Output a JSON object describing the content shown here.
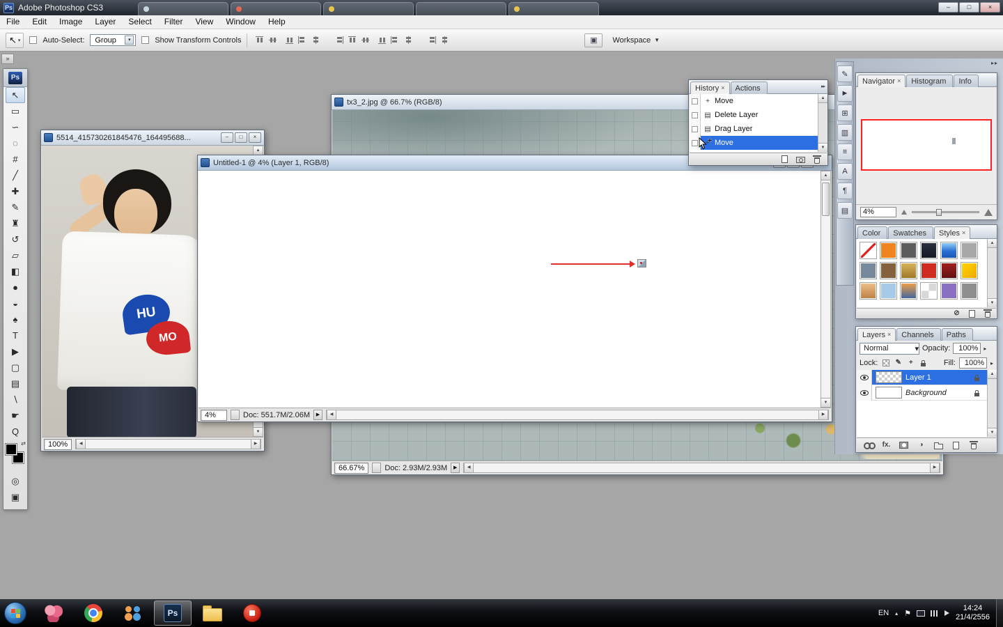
{
  "colors": {
    "selection_blue": "#2b6fe3",
    "annotation_red": "#e03028",
    "navigator_frame_red": "#ff1f1f",
    "photoshop_badge_blue": "#12294f",
    "taskbar_black": "#0d0f13"
  },
  "ui": {
    "arrow_down": "▾",
    "arrow_down_solid": "▼",
    "arrow_right": "▸",
    "chevrons": "▸▸",
    "collapse": "»",
    "scroll_up": "▲",
    "scroll_down": "▼",
    "scroll_left": "◀",
    "scroll_right": "▶",
    "swap": "⇄",
    "quickmask": "◎",
    "screenmode": "▣"
  },
  "titlebar": {
    "title": "Adobe Photoshop CS3",
    "badge": "Ps",
    "min": "–",
    "max": "□",
    "close": "×",
    "ghost_tabs": [
      {
        "dot": "#c8d4e0"
      },
      {
        "dot": "#df6a55"
      },
      {
        "dot": "#e6c44f"
      },
      {
        "dot": ""
      },
      {
        "dot": "#e6c44f"
      }
    ]
  },
  "menu": {
    "items": [
      "File",
      "Edit",
      "Image",
      "Layer",
      "Select",
      "Filter",
      "View",
      "Window",
      "Help"
    ]
  },
  "options": {
    "tool_glyph": "↖",
    "auto_select_label": "Auto-Select:",
    "auto_select_value": "Group",
    "show_transform_label": "Show Transform Controls",
    "bridge_glyph": "▣",
    "workspace_label": "Workspace",
    "align_icons": [
      {
        "name": "align-top-edges-icon",
        "v": "top"
      },
      {
        "name": "align-vertical-centers-icon",
        "v": "vmid"
      },
      {
        "name": "align-bottom-edges-icon",
        "v": "bot"
      },
      {
        "name": "align-left-edges-icon",
        "v": "left"
      },
      {
        "name": "align-horizontal-centers-icon",
        "v": "hmid"
      },
      {
        "name": "align-right-edges-icon",
        "v": "right"
      },
      {
        "name": "distribute-top-edges-icon",
        "v": "top"
      },
      {
        "name": "distribute-vertical-centers-icon",
        "v": "vmid"
      },
      {
        "name": "distribute-bottom-edges-icon",
        "v": "bot"
      },
      {
        "name": "distribute-left-edges-icon",
        "v": "left"
      },
      {
        "name": "distribute-horizontal-centers-icon",
        "v": "hmid"
      },
      {
        "name": "distribute-right-edges-icon",
        "v": "right"
      },
      {
        "name": "auto-align-layers-icon",
        "v": "hmid"
      }
    ]
  },
  "toolbox": {
    "logo": "Ps",
    "tools": [
      {
        "name": "move-tool",
        "glyph": "↖",
        "selected": true
      },
      {
        "name": "rectangular-marquee-tool",
        "glyph": "▭"
      },
      {
        "name": "lasso-tool",
        "glyph": "∽"
      },
      {
        "name": "quick-selection-tool",
        "glyph": "◌"
      },
      {
        "name": "crop-tool",
        "glyph": "#"
      },
      {
        "name": "slice-tool",
        "glyph": "╱"
      },
      {
        "name": "spot-healing-brush-tool",
        "glyph": "✚"
      },
      {
        "name": "brush-tool",
        "glyph": "✎"
      },
      {
        "name": "clone-stamp-tool",
        "glyph": "♜"
      },
      {
        "name": "history-brush-tool",
        "glyph": "↺"
      },
      {
        "name": "eraser-tool",
        "glyph": "▱"
      },
      {
        "name": "gradient-tool",
        "glyph": "◧"
      },
      {
        "name": "blur-tool",
        "glyph": "●"
      },
      {
        "name": "dodge-tool",
        "glyph": "◒"
      },
      {
        "name": "pen-tool",
        "glyph": "♠"
      },
      {
        "name": "type-tool",
        "glyph": "T"
      },
      {
        "name": "path-selection-tool",
        "glyph": "▶"
      },
      {
        "name": "shape-tool",
        "glyph": "▢"
      },
      {
        "name": "notes-tool",
        "glyph": "▤"
      },
      {
        "name": "eyedropper-tool",
        "glyph": "∖"
      },
      {
        "name": "hand-tool",
        "glyph": "☛"
      },
      {
        "name": "zoom-tool",
        "glyph": "Q"
      }
    ]
  },
  "docs": {
    "texture": {
      "title": "tx3_2.jpg @ 66.7% (RGB/8)",
      "zoom": "66.67%",
      "doc": "Doc: 2.93M/2.93M"
    },
    "photo": {
      "title": "5514_415730261845476_164495688...",
      "zoom": "100%",
      "logo_top": "HU",
      "logo_bottom": "MO"
    },
    "untitled": {
      "title": "Untitled-1 @ 4% (Layer 1, RGB/8)",
      "zoom": "4%",
      "doc": "Doc: 551.7M/2.06M"
    }
  },
  "history": {
    "tabs": [
      {
        "label": "History",
        "close": "×",
        "active": true
      },
      {
        "label": "Actions",
        "close": "",
        "active": false
      }
    ],
    "items": [
      {
        "label": "Move",
        "glyph": "+",
        "selected": false
      },
      {
        "label": "Delete Layer",
        "glyph": "▤",
        "selected": false
      },
      {
        "label": "Drag Layer",
        "glyph": "▤",
        "selected": false
      },
      {
        "label": "Move",
        "glyph": "+",
        "selected": true
      }
    ],
    "buttons": [
      {
        "name": "new-document-from-state-icon",
        "k": "page",
        "glyph": ""
      },
      {
        "name": "new-snapshot-icon",
        "k": "camera",
        "glyph": ""
      },
      {
        "name": "delete-state-icon",
        "k": "trash",
        "glyph": ""
      }
    ]
  },
  "dock_icons": [
    {
      "name": "brushes-panel-icon",
      "glyph": "✎"
    },
    {
      "name": "tool-presets-panel-icon",
      "glyph": "►"
    },
    {
      "name": "clone-source-panel-icon",
      "glyph": "⊞"
    },
    {
      "name": "histogram-panel-icon",
      "glyph": "▥"
    },
    {
      "name": "layer-comps-panel-icon",
      "glyph": "≡"
    },
    {
      "name": "character-panel-icon",
      "glyph": "A"
    },
    {
      "name": "paragraph-panel-icon",
      "glyph": "¶"
    },
    {
      "name": "info-panel-icon",
      "glyph": "▤"
    }
  ],
  "navigator": {
    "tabs": [
      {
        "label": "Navigator",
        "close": "×",
        "active": true
      },
      {
        "label": "Histogram",
        "close": "",
        "active": false
      },
      {
        "label": "Info",
        "close": "",
        "active": false
      }
    ],
    "zoom": "4%"
  },
  "styles": {
    "tabs": [
      {
        "label": "Color",
        "close": "",
        "active": false
      },
      {
        "label": "Swatches",
        "close": "",
        "active": false
      },
      {
        "label": "Styles",
        "close": "×",
        "active": true
      }
    ],
    "swatches": [
      {
        "name": "default-style",
        "bg": "linear-gradient(135deg,#ffffff 44%,#e02020 46%,#e02020 54%,#ffffff 56%)"
      },
      {
        "name": "style-orange",
        "bg": "#ef8420"
      },
      {
        "name": "style-dark-gray",
        "bg": "#5c5c5c"
      },
      {
        "name": "style-dark-texture",
        "bg": "linear-gradient(#2b3140,#151823)"
      },
      {
        "name": "style-blue-glass",
        "bg": "linear-gradient(#85c4f2 10%,#2a6fd4 55%,#1a55b0)"
      },
      {
        "name": "style-gray",
        "bg": "#a8a8a8"
      },
      {
        "name": "style-slate",
        "bg": "#76889a"
      },
      {
        "name": "style-brown",
        "bg": "#85603c"
      },
      {
        "name": "style-gold",
        "bg": "linear-gradient(#d9b65c,#9c7526)"
      },
      {
        "name": "style-red",
        "bg": "#cf2d22"
      },
      {
        "name": "style-maroon",
        "bg": "linear-gradient(#a42222,#5e0f0f)"
      },
      {
        "name": "style-yellow",
        "bg": "linear-gradient(135deg,#ffd900,#efa400)"
      },
      {
        "name": "style-tan",
        "bg": "linear-gradient(#f0c189,#bd7f41)"
      },
      {
        "name": "style-light-blue",
        "bg": "#a6cbe8"
      },
      {
        "name": "style-sunset",
        "bg": "linear-gradient(#f2a244,#3f62a2)"
      },
      {
        "name": "style-transparent",
        "bg": "conic-gradient(#d8d8d8 0 25%,#ffffff 0 50%,#d8d8d8 0 75%,#ffffff 0)"
      },
      {
        "name": "style-purple",
        "bg": "#8a70c2"
      },
      {
        "name": "style-gray-2",
        "bg": "#8f8f8f"
      }
    ],
    "buttons": [
      {
        "name": "clear-style-icon",
        "k": "glyph",
        "glyph": "⊘"
      },
      {
        "name": "new-style-icon",
        "k": "page",
        "glyph": ""
      },
      {
        "name": "delete-style-icon",
        "k": "trash",
        "glyph": ""
      }
    ]
  },
  "layers": {
    "tabs": [
      {
        "label": "Layers",
        "close": "×",
        "active": true
      },
      {
        "label": "Channels",
        "close": "",
        "active": false
      },
      {
        "label": "Paths",
        "close": "",
        "active": false
      }
    ],
    "blend_mode": "Normal",
    "opacity_label": "Opacity:",
    "opacity": "100%",
    "lock_label": "Lock:",
    "fill_label": "Fill:",
    "fill": "100%",
    "lock_icons": [
      {
        "name": "lock-transparent-pixels-icon",
        "k": "checker",
        "glyph": ""
      },
      {
        "name": "lock-image-pixels-icon",
        "k": "glyph",
        "glyph": "✎"
      },
      {
        "name": "lock-position-icon",
        "k": "glyph",
        "glyph": "+"
      },
      {
        "name": "lock-all-icon",
        "k": "lockpad",
        "glyph": ""
      }
    ],
    "items": [
      {
        "name": "Layer 1",
        "selected": true,
        "checker": true,
        "italic": false,
        "locked": false
      },
      {
        "name": "Background",
        "selected": false,
        "checker": false,
        "italic": true,
        "locked": true
      }
    ],
    "buttons": [
      {
        "name": "link-layers-icon",
        "k": "link",
        "glyph": ""
      },
      {
        "name": "layer-style-icon",
        "k": "glyph",
        "glyph": "fx."
      },
      {
        "name": "add-layer-mask-icon",
        "k": "mask",
        "glyph": ""
      },
      {
        "name": "adjustment-layer-icon",
        "k": "glyph",
        "glyph": "◑"
      },
      {
        "name": "new-group-icon",
        "k": "folder",
        "glyph": ""
      },
      {
        "name": "new-layer-icon",
        "k": "page",
        "glyph": ""
      },
      {
        "name": "delete-layer-icon",
        "k": "trash",
        "glyph": ""
      }
    ]
  },
  "taskbar": {
    "apps": [
      {
        "name": "taskbar-pink-app",
        "k": "pink",
        "glyph": "",
        "active": false
      },
      {
        "name": "taskbar-browser",
        "k": "chrome",
        "glyph": "",
        "active": false
      },
      {
        "name": "taskbar-people-app",
        "k": "people",
        "glyph": "",
        "active": false
      },
      {
        "name": "taskbar-photoshop",
        "k": "ps",
        "glyph": "Ps",
        "active": true
      },
      {
        "name": "taskbar-explorer",
        "k": "folder",
        "glyph": "",
        "active": false
      },
      {
        "name": "taskbar-red-app",
        "k": "red",
        "glyph": "",
        "active": false
      }
    ],
    "tray_icons": [
      {
        "name": "action-center-icon",
        "k": "glyph",
        "glyph": "⚑"
      },
      {
        "name": "display-icon",
        "k": "mon",
        "glyph": ""
      },
      {
        "name": "network-icon",
        "k": "net",
        "glyph": ""
      },
      {
        "name": "volume-icon",
        "k": "vol",
        "glyph": ""
      }
    ],
    "tray": {
      "lang": "EN",
      "expand": "▴",
      "time": "14:24",
      "date": "21/4/2556"
    }
  }
}
